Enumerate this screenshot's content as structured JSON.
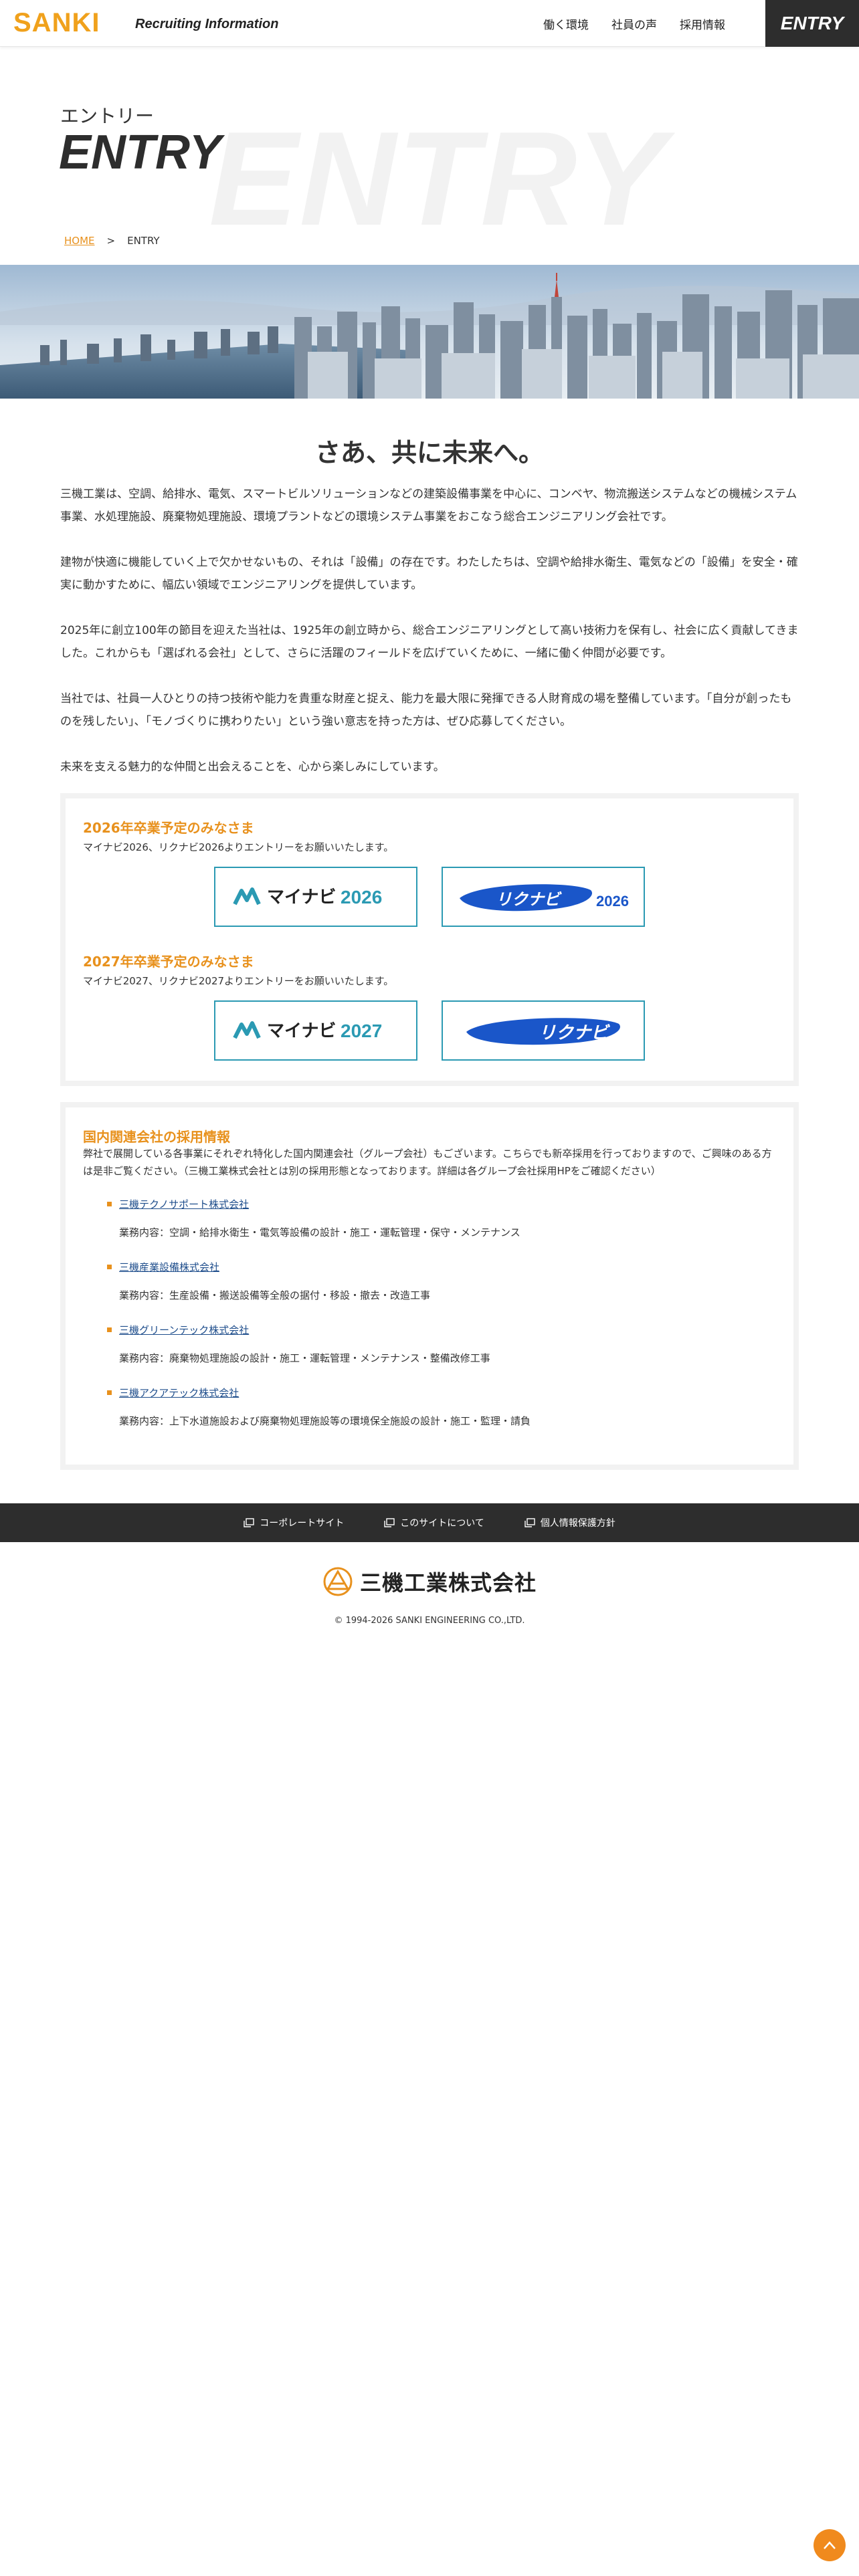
{
  "header": {
    "logo": "SANKI",
    "logo_sub": "Recruiting Information",
    "nav": [
      "働く環境",
      "社員の声",
      "採用情報"
    ],
    "entry": "ENTRY"
  },
  "hero": {
    "title_jp": "エントリー",
    "title_en": "ENTRY",
    "bg_text": "ENTRY",
    "breadcrumb": {
      "home": "HOME",
      "sep": ">",
      "current": "ENTRY"
    }
  },
  "intro": {
    "catch": "さあ、共に未来へ。",
    "paragraphs": [
      "三機工業は、空調、給排水、電気、スマートビルソリューションなどの建築設備事業を中心に、コンベヤ、物流搬送システムなどの機械システム事業、水処理施設、廃棄物処理施設、環境プラントなどの環境システム事業をおこなう総合エンジニアリング会社です。",
      "建物が快適に機能していく上で欠かせないもの、それは「設備」の存在です。わたしたちは、空調や給排水衛生、電気などの「設備」を安全・確実に動かすために、幅広い領域でエンジニアリングを提供しています。",
      "2025年に創立100年の節目を迎えた当社は、1925年の創立時から、総合エンジニアリングとして高い技術力を保有し、社会に広く貢献してきました。これからも「選ばれる会社」として、さらに活躍のフィールドを広げていくために、一緒に働く仲間が必要です。",
      "当社では、社員一人ひとりの持つ技術や能力を貴重な財産と捉え、能力を最大限に発揮できる人財育成の場を整備しています。「自分が創ったものを残したい」、「モノづくりに携わりたい」という強い意志を持った方は、ぜひ応募してください。",
      "未来を支える魅力的な仲間と出会えることを、心から楽しみにしています。"
    ]
  },
  "entry_box": {
    "y2026": {
      "heading": "2026年卒業予定のみなさま",
      "text": "マイナビ2026、リクナビ2026よりエントリーをお願いいたします。",
      "mynavi": "マイナビ",
      "mynavi_year": "2026",
      "rikunabi": "リクナビ",
      "rikunabi_year": "2026"
    },
    "y2027": {
      "heading": "2027年卒業予定のみなさま",
      "text": "マイナビ2027、リクナビ2027よりエントリーをお願いいたします。",
      "mynavi": "マイナビ",
      "mynavi_year": "2027",
      "rikunabi": "リクナビ"
    }
  },
  "group_box": {
    "heading": "国内関連会社の採用情報",
    "text": "弊社で展開している各事業にそれぞれ特化した国内関連会社（グループ会社）もございます。こちらでも新卒採用を行っておりますので、ご興味のある方は是非ご覧ください。（三機工業株式会社とは別の採用形態となっております。詳細は各グループ会社採用HPをご確認ください）",
    "companies": [
      {
        "name": "三機テクノサポート株式会社",
        "desc": "業務内容：空調・給排水衛生・電気等設備の設計・施工・運転管理・保守・メンテナンス"
      },
      {
        "name": "三機産業設備株式会社",
        "desc": "業務内容：生産設備・搬送設備等全般の据付・移設・撤去・改造工事"
      },
      {
        "name": "三機グリーンテック株式会社",
        "desc": "業務内容：廃棄物処理施設の設計・施工・運転管理・メンテナンス・整備改修工事"
      },
      {
        "name": "三機アクアテック株式会社",
        "desc": "業務内容：上下水道施設および廃棄物処理施設等の環境保全施設の設計・施工・監理・請負"
      }
    ]
  },
  "footer": {
    "links": [
      "コーポレートサイト",
      "このサイトについて",
      "個人情報保護方針"
    ],
    "company": "三機工業株式会社",
    "copyright": "© 1994-2026 SANKI ENGINEERING CO.,LTD."
  },
  "colors": {
    "accent": "#e8911d",
    "dark": "#2d2d2d",
    "logo": "#f0a11c",
    "mynavi": "#2b9ab3",
    "rikunabi": "#1a56c9"
  }
}
